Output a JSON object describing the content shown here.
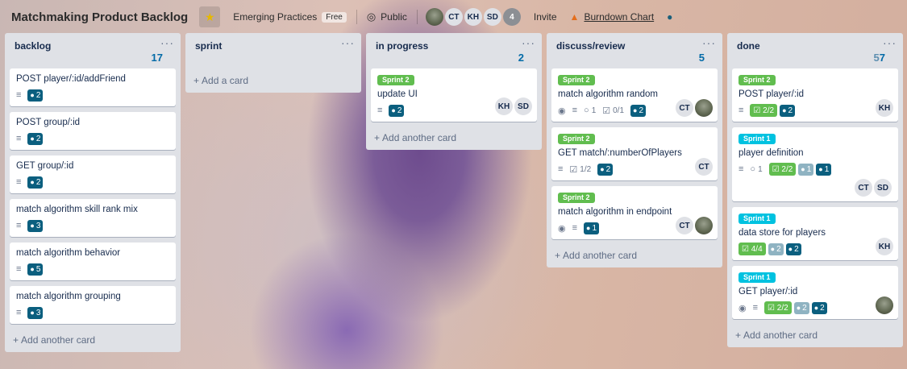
{
  "header": {
    "board_title": "Matchmaking Product Backlog",
    "star_icon": "star-icon",
    "team_name": "Emerging Practices",
    "team_badge": "Free",
    "visibility": "Public",
    "members": [
      "CT",
      "KH",
      "SD"
    ],
    "member_overflow": "4",
    "invite": "Invite",
    "burndown": "Burndown Chart"
  },
  "lists": [
    {
      "title": "backlog",
      "count": "17",
      "add_label": "Add another card",
      "cards": [
        {
          "title": "POST player/:id/addFriend",
          "points": "2"
        },
        {
          "title": "POST group/:id",
          "points": "2"
        },
        {
          "title": "GET group/:id",
          "points": "2"
        },
        {
          "title": "match algorithm skill rank mix",
          "points": "3"
        },
        {
          "title": "match algorithm behavior",
          "points": "5"
        },
        {
          "title": "match algorithm grouping",
          "points": "3"
        }
      ]
    },
    {
      "title": "sprint",
      "add_label": "Add a card",
      "cards": []
    },
    {
      "title": "in progress",
      "count": "2",
      "add_label": "Add another card",
      "cards": [
        {
          "label": "Sprint 2",
          "title": "update UI",
          "points": "2",
          "members": [
            "KH",
            "SD"
          ]
        }
      ]
    },
    {
      "title": "discuss/review",
      "count": "5",
      "add_label": "Add another card",
      "cards": [
        {
          "label": "Sprint 2",
          "title": "match algorithm random",
          "watchers": "",
          "comments": "1",
          "checklist": "0/1",
          "points": "2",
          "members": [
            "CT"
          ]
        },
        {
          "label": "Sprint 2",
          "title": "GET match/:numberOfPlayers",
          "checklist": "1/2",
          "points": "2",
          "members": [
            "CT"
          ]
        },
        {
          "label": "Sprint 2",
          "title": "match algorithm in endpoint",
          "points": "1",
          "members": [
            "CT"
          ]
        }
      ]
    },
    {
      "title": "done",
      "count_dim": "5",
      "count": "7",
      "add_label": "Add another card",
      "cards": [
        {
          "label": "Sprint 2",
          "title": "POST player/:id",
          "checklist": "2/2",
          "points": "2",
          "members": [
            "KH"
          ]
        },
        {
          "label": "Sprint 1",
          "title": "player definition",
          "comments": "1",
          "checklist": "2/2",
          "points_light": "1",
          "points": "1",
          "members": [
            "CT",
            "SD"
          ]
        },
        {
          "label": "Sprint 1",
          "title": "data store for players",
          "checklist": "4/4",
          "points_light": "2",
          "points": "2",
          "members": [
            "KH"
          ]
        },
        {
          "label": "Sprint 1",
          "title": "GET player/:id",
          "checklist": "2/2",
          "points_light": "2",
          "points": "2"
        }
      ]
    }
  ],
  "colors": {
    "sprint2_label": "#61bd4f",
    "sprint1_label": "#00c2e0",
    "points_badge": "#0b5f7f",
    "checklist_done": "#61bd4f"
  }
}
